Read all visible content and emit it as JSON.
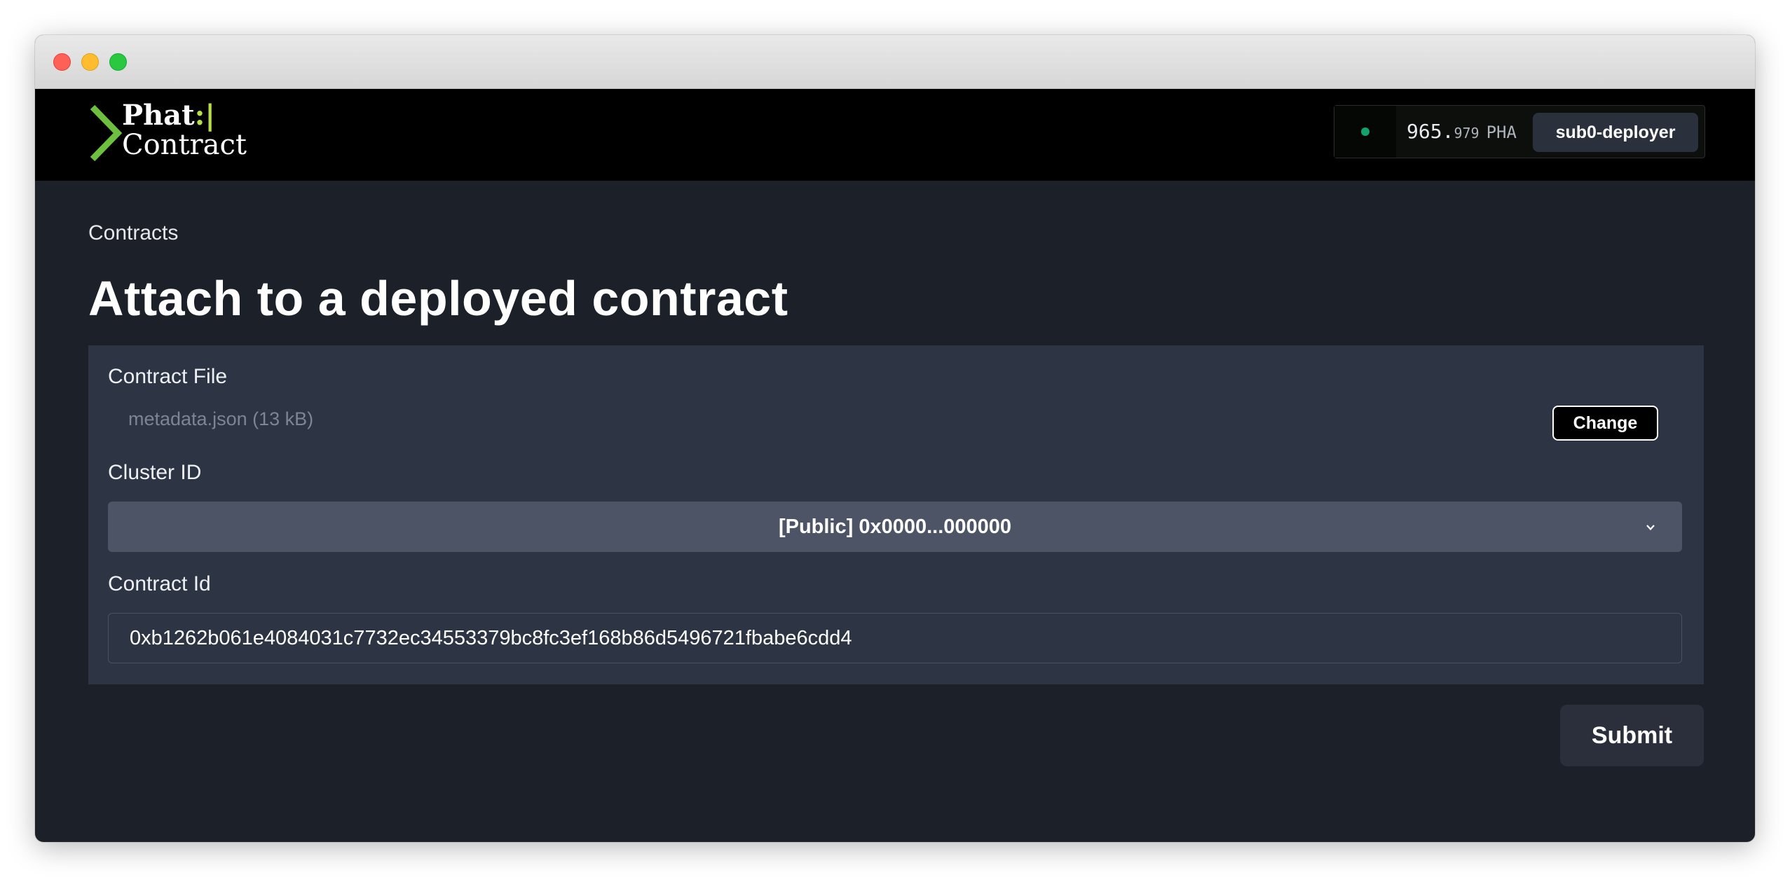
{
  "window": {
    "controls": [
      "close",
      "minimize",
      "zoom"
    ]
  },
  "header": {
    "logo": {
      "line1_main": "Phat",
      "line1_accent": ":|",
      "line2": "Contract",
      "accent_color": "#b6e046",
      "chevron_color": "#6cbf3f"
    },
    "account": {
      "status_color": "#11a36b",
      "balance_integer": "965",
      "balance_separator": ".",
      "balance_decimal": "979",
      "balance_unit": "PHA",
      "account_name": "sub0-deployer"
    }
  },
  "main": {
    "breadcrumb": "Contracts",
    "title": "Attach to a deployed contract",
    "form": {
      "contract_file": {
        "label": "Contract File",
        "file_name": "metadata.json (13 kB)",
        "change_label": "Change"
      },
      "cluster": {
        "label": "Cluster ID",
        "selected": "[Public] 0x0000...000000"
      },
      "contract_id": {
        "label": "Contract Id",
        "value": "0xb1262b061e4084031c7732ec34553379bc8fc3ef168b86d5496721fbabe6cdd4"
      }
    },
    "submit_label": "Submit"
  }
}
